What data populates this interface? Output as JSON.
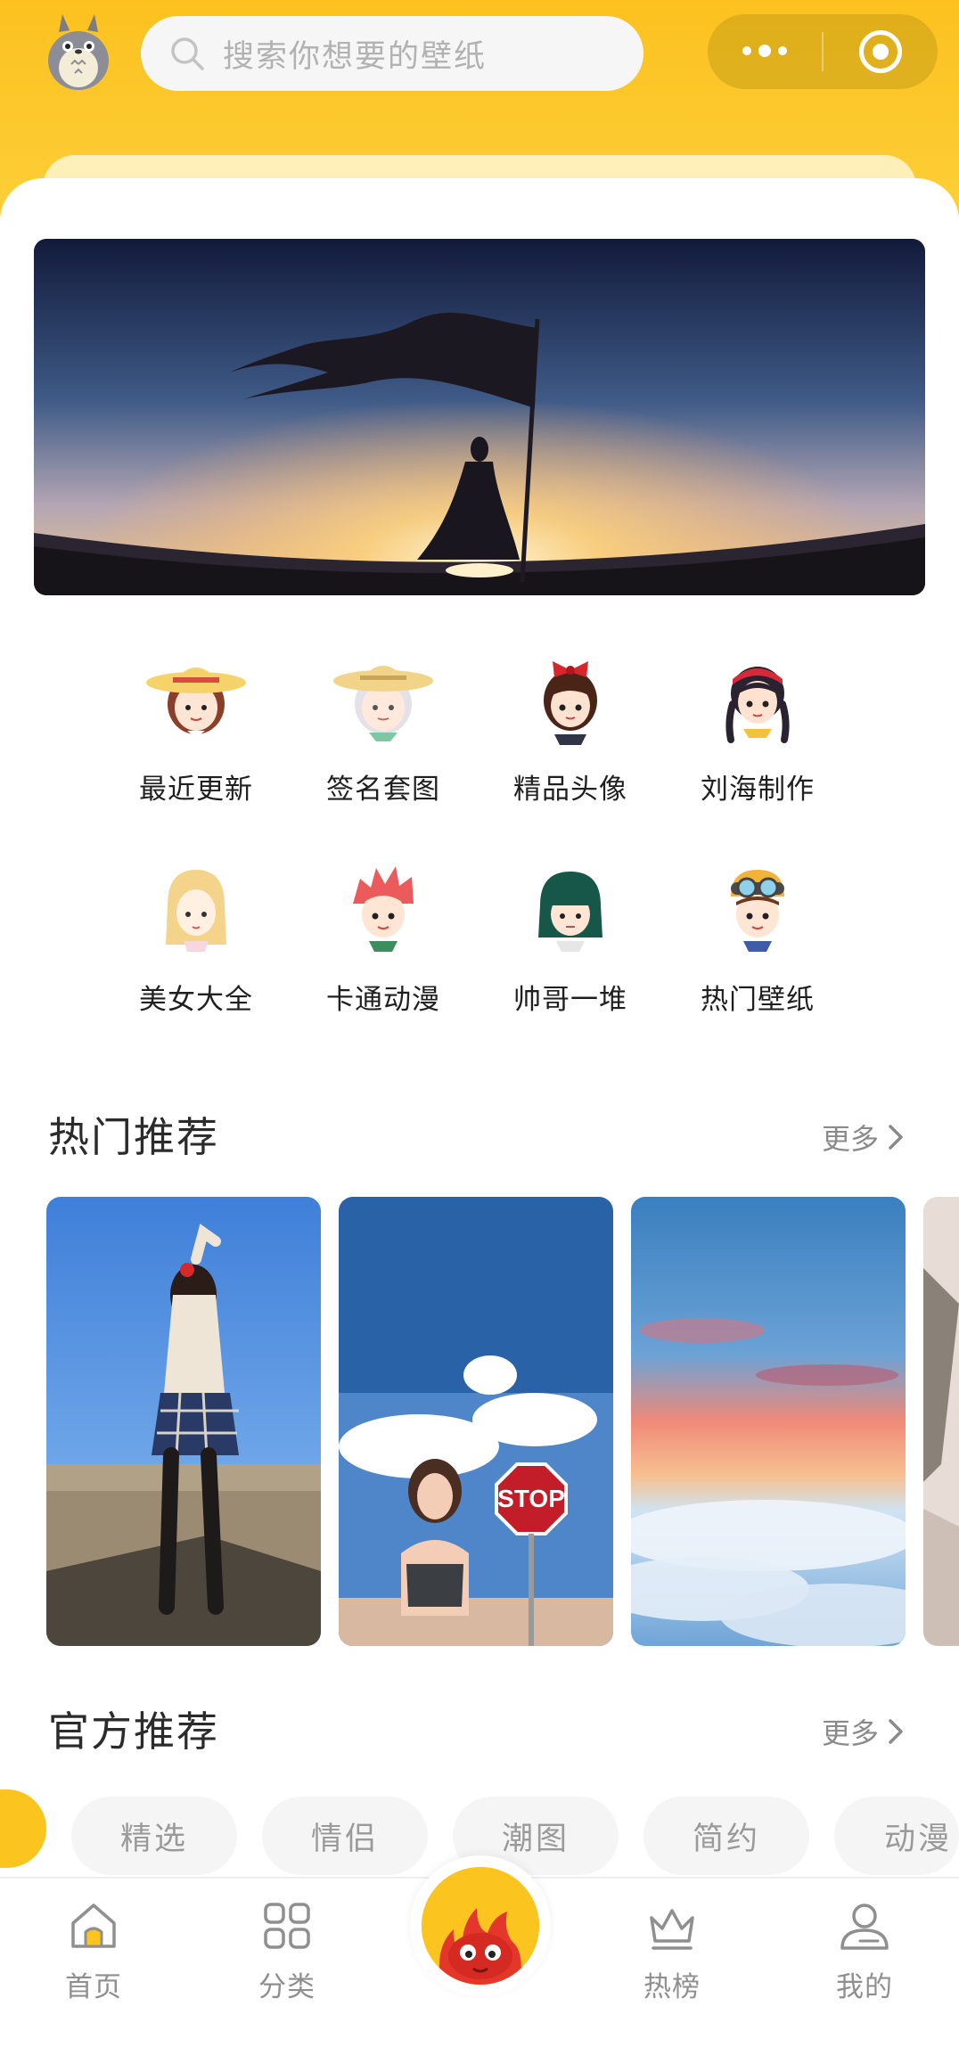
{
  "header": {
    "search_placeholder": "搜索你想要的壁纸"
  },
  "categories": [
    {
      "label": "最近更新",
      "icon": "girl-straw-hat-icon"
    },
    {
      "label": "签名套图",
      "icon": "silver-hair-hat-icon"
    },
    {
      "label": "精品头像",
      "icon": "girl-red-bow-icon"
    },
    {
      "label": "刘海制作",
      "icon": "girl-braids-icon"
    },
    {
      "label": "美女大全",
      "icon": "blonde-girl-icon"
    },
    {
      "label": "卡通动漫",
      "icon": "red-hair-boy-icon"
    },
    {
      "label": "帅哥一堆",
      "icon": "green-hair-icon"
    },
    {
      "label": "热门壁纸",
      "icon": "goggles-boy-icon"
    }
  ],
  "hot": {
    "title": "热门推荐",
    "more": "更多"
  },
  "official": {
    "title": "官方推荐",
    "more": "更多"
  },
  "chips": [
    "精选",
    "情侣",
    "潮图",
    "简约",
    "动漫"
  ],
  "tabbar": {
    "home": "首页",
    "category": "分类",
    "ranking": "热榜",
    "mine": "我的"
  },
  "colors": {
    "brand_yellow": "#fcc41f",
    "muted_text": "#8f8f8f"
  }
}
